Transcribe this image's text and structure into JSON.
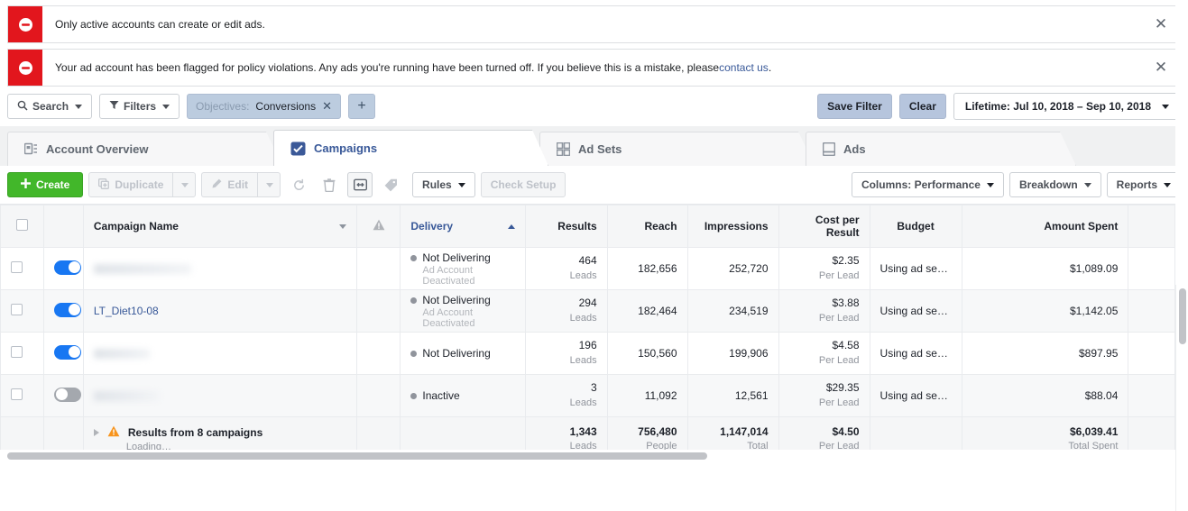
{
  "alerts": [
    {
      "icon": "block-icon",
      "text": "Only active accounts can create or edit ads.",
      "link_text": "",
      "text_after_link": "",
      "close_label": "✕"
    },
    {
      "icon": "block-icon",
      "text": "Your ad account has been flagged for policy violations. Any ads you're running have been turned off. If you believe this is a mistake, please ",
      "link_text": "contact us",
      "text_after_link": ".",
      "close_label": "✕"
    }
  ],
  "filterbar": {
    "search_label": "Search",
    "search_icon": "search-icon",
    "filters_label": "Filters",
    "filters_icon": "funnel-icon",
    "chip": {
      "label": "Objectives:",
      "value": "Conversions",
      "remove_icon": "✕"
    },
    "add_filter_label": "+",
    "save_filter_label": "Save Filter",
    "clear_label": "Clear",
    "date_range": "Lifetime: Jul 10, 2018 – Sep 10, 2018"
  },
  "tabs": [
    {
      "label": "Account Overview",
      "icon": "account-overview-icon",
      "active": false
    },
    {
      "label": "Campaigns",
      "icon": "campaigns-checkbox-icon",
      "active": true
    },
    {
      "label": "Ad Sets",
      "icon": "ad-sets-grid-icon",
      "active": false
    },
    {
      "label": "Ads",
      "icon": "ads-card-icon",
      "active": false
    }
  ],
  "actionbar": {
    "create_label": "Create",
    "create_icon": "plus-icon",
    "duplicate_label": "Duplicate",
    "duplicate_icon": "duplicate-icon",
    "edit_label": "Edit",
    "edit_icon": "pencil-icon",
    "refresh_icon": "refresh-icon",
    "delete_icon": "trash-icon",
    "abtest_icon": "ab-test-icon",
    "tag_icon": "tag-icon",
    "rules_label": "Rules",
    "check_setup_label": "Check Setup",
    "columns_label": "Columns: Performance",
    "breakdown_label": "Breakdown",
    "reports_label": "Reports"
  },
  "table": {
    "headers": {
      "select_all": "select-all-checkbox",
      "toggle_col": "",
      "campaign_name": "Campaign Name",
      "warning": "warning-icon",
      "delivery": "Delivery",
      "results": "Results",
      "reach": "Reach",
      "impressions": "Impressions",
      "cost_per_result_line1": "Cost per",
      "cost_per_result_line2": "Result",
      "budget": "Budget",
      "amount_spent": "Amount Spent"
    },
    "sorted_column": "Delivery",
    "sort_direction": "asc",
    "rows": [
      {
        "toggle_on": true,
        "name": "",
        "name_blurred": true,
        "delivery": "Not Delivering",
        "delivery_sub": "Ad Account Deactivated",
        "results": "464",
        "results_unit": "Leads",
        "reach": "182,656",
        "impressions": "252,720",
        "cost_per_result": "$2.35",
        "cost_unit": "Per Lead",
        "budget": "Using ad se…",
        "amount_spent": "$1,089.09"
      },
      {
        "toggle_on": true,
        "name": "LT_Diet10-08",
        "name_blurred": false,
        "delivery": "Not Delivering",
        "delivery_sub": "Ad Account Deactivated",
        "results": "294",
        "results_unit": "Leads",
        "reach": "182,464",
        "impressions": "234,519",
        "cost_per_result": "$3.88",
        "cost_unit": "Per Lead",
        "budget": "Using ad se…",
        "amount_spent": "$1,142.05"
      },
      {
        "toggle_on": true,
        "name": "",
        "name_blurred": true,
        "delivery": "Not Delivering",
        "delivery_sub": "",
        "results": "196",
        "results_unit": "Leads",
        "reach": "150,560",
        "impressions": "199,906",
        "cost_per_result": "$4.58",
        "cost_unit": "Per Lead",
        "budget": "Using ad se…",
        "amount_spent": "$897.95"
      },
      {
        "toggle_on": false,
        "name": "",
        "name_blurred": true,
        "delivery": "Inactive",
        "delivery_sub": "",
        "results": "3",
        "results_unit": "Leads",
        "reach": "11,092",
        "impressions": "12,561",
        "cost_per_result": "$29.35",
        "cost_unit": "Per Lead",
        "budget": "Using ad se…",
        "amount_spent": "$88.04"
      }
    ],
    "totals": {
      "warning_icon": "warning-triangle-icon",
      "label": "Results from 8 campaigns",
      "loading": "Loading…",
      "results": "1,343",
      "results_unit": "Leads",
      "reach": "756,480",
      "reach_unit": "People",
      "impressions": "1,147,014",
      "impressions_unit": "Total",
      "cost_per_result": "$4.50",
      "cost_unit": "Per Lead",
      "budget": "",
      "amount_spent": "$6,039.41",
      "amount_spent_unit": "Total Spent"
    }
  },
  "colors": {
    "alert_red": "#e2161d",
    "create_green": "#42b72a",
    "link_blue": "#385898",
    "toggle_blue": "#1877f2",
    "warning_orange": "#f7941d",
    "chip_blue": "#bcccdf"
  }
}
